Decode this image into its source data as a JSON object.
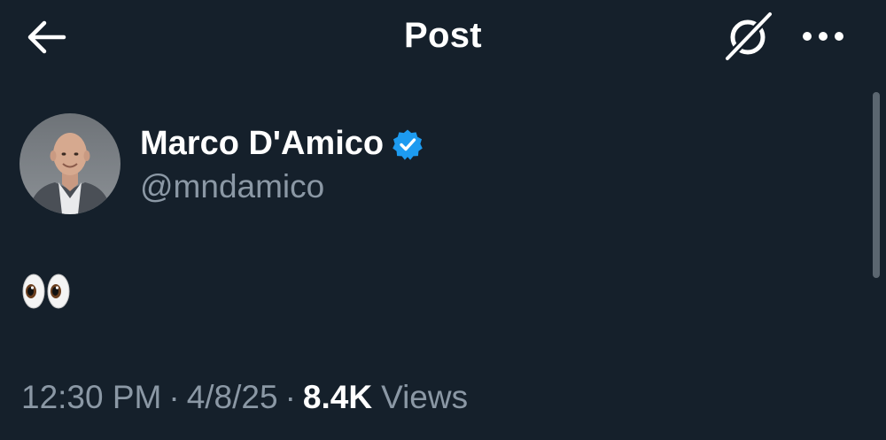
{
  "header": {
    "title": "Post",
    "back_icon": "arrow-left-icon",
    "grok_icon": "grok-icon",
    "more_icon": "more-horizontal-icon"
  },
  "author": {
    "display_name": "Marco D'Amico",
    "handle": "@mndamico",
    "verified_icon": "verified-badge-icon",
    "verified_color": "#1d9bf0"
  },
  "post": {
    "text": "👀"
  },
  "meta": {
    "time": "12:30 PM",
    "separator": "·",
    "date": "4/8/25",
    "views_count": "8.4K",
    "views_label": "Views"
  },
  "colors": {
    "background": "#15202b",
    "primary_text": "#ffffff",
    "secondary_text": "#8b98a5"
  }
}
